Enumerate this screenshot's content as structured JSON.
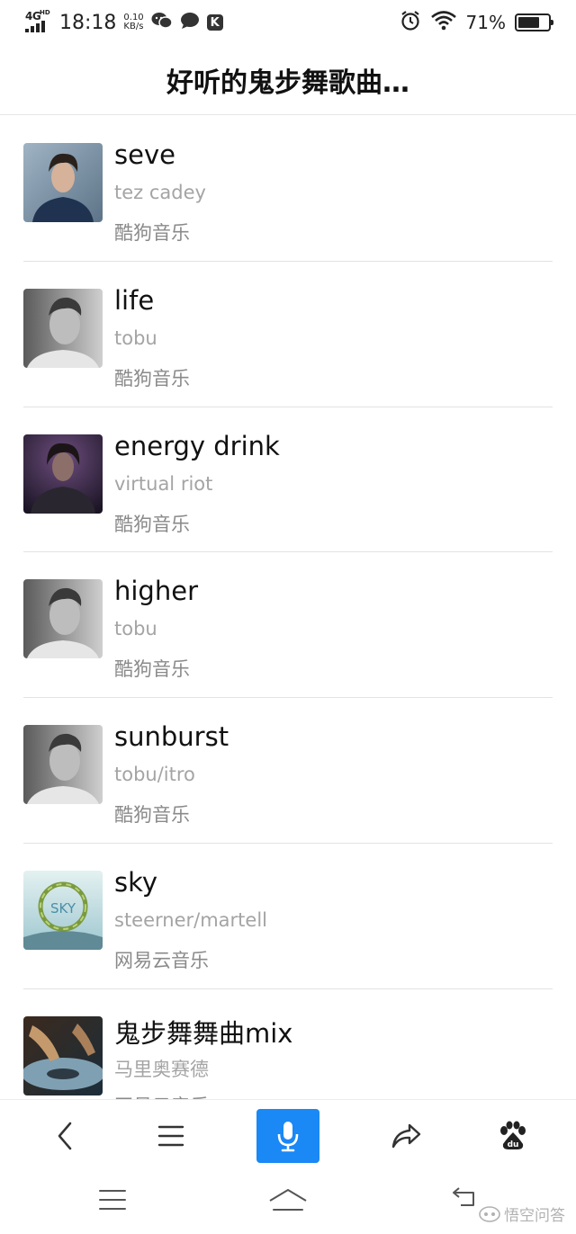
{
  "status_bar": {
    "network": "4G",
    "network_sup": "HD",
    "time": "18:18",
    "speed_value": "0.10",
    "speed_unit": "KB/s",
    "battery_percent": "71%",
    "battery_level": 0.71,
    "icons": [
      "signal-icon",
      "wechat-icon",
      "message-icon",
      "k-app-icon",
      "alarm-icon",
      "wifi-icon",
      "battery-icon"
    ],
    "k_badge": "K"
  },
  "header": {
    "title": "好听的鬼步舞歌曲…"
  },
  "songs": [
    {
      "title": "seve",
      "artist": "tez cadey",
      "source": "酷狗音乐"
    },
    {
      "title": "life",
      "artist": "tobu",
      "source": "酷狗音乐"
    },
    {
      "title": "energy drink",
      "artist": "virtual riot",
      "source": "酷狗音乐"
    },
    {
      "title": "higher",
      "artist": "tobu",
      "source": "酷狗音乐"
    },
    {
      "title": "sunburst",
      "artist": "tobu/itro",
      "source": "酷狗音乐"
    },
    {
      "title": "sky",
      "artist": "steerner/martell",
      "source": "网易云音乐",
      "cover_text": "SKY"
    },
    {
      "title": "鬼步舞舞曲mix",
      "artist": "马里奥赛德",
      "source": "网易云音乐"
    }
  ],
  "toolbar": {
    "items": [
      "back-icon",
      "menu-icon",
      "microphone-icon",
      "share-icon",
      "baidu-paw-icon"
    ],
    "baidu_label": "du",
    "accent_color": "#1a88f5"
  },
  "system_nav": {
    "items": [
      "menu-icon",
      "home-icon",
      "back-icon"
    ]
  },
  "watermark": {
    "text": "悟空问答"
  }
}
